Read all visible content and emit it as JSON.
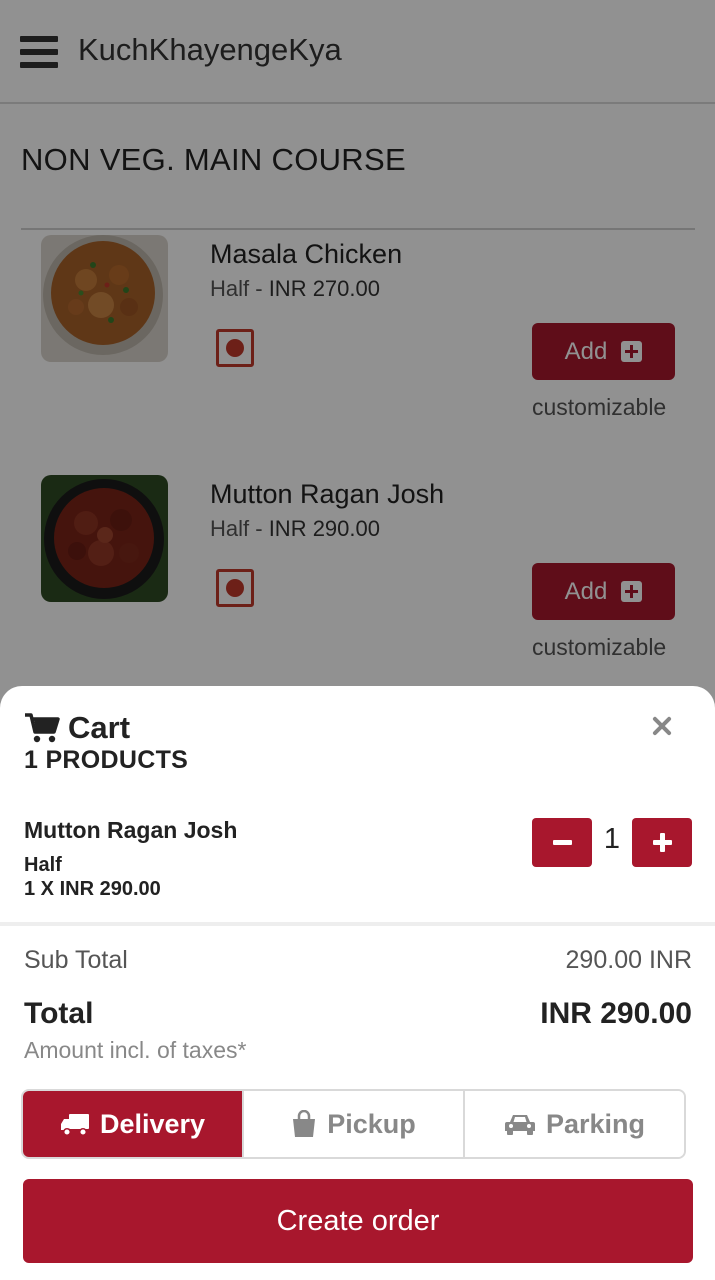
{
  "app": {
    "title": "KuchKhayengeKya"
  },
  "category": {
    "title": "NON VEG. MAIN COURSE"
  },
  "menu_items": [
    {
      "name": "Masala Chicken",
      "variant": "Half",
      "price_sep": " - ",
      "price": "INR 270.00",
      "add_label": "Add",
      "note": "customizable"
    },
    {
      "name": "Mutton Ragan Josh",
      "variant": "Half",
      "price_sep": " - ",
      "price": "INR 290.00",
      "add_label": "Add",
      "note": "customizable"
    }
  ],
  "cart": {
    "title": "Cart",
    "count_label": "1 PRODUCTS",
    "item": {
      "name": "Mutton Ragan Josh",
      "variant": "Half",
      "line": "1 X INR 290.00",
      "quantity": "1"
    },
    "subtotal_label": "Sub Total",
    "subtotal_value": "290.00 INR",
    "total_label": "Total",
    "total_value": "INR 290.00",
    "taxes_note": "Amount incl. of taxes*",
    "modes": [
      {
        "label": "Delivery",
        "icon": "truck-icon",
        "active": true
      },
      {
        "label": "Pickup",
        "icon": "shopping-bag-icon",
        "active": false
      },
      {
        "label": "Parking",
        "icon": "car-icon",
        "active": false
      }
    ],
    "create_label": "Create order"
  },
  "colors": {
    "accent": "#a8172d",
    "nonveg": "#c0392b"
  }
}
